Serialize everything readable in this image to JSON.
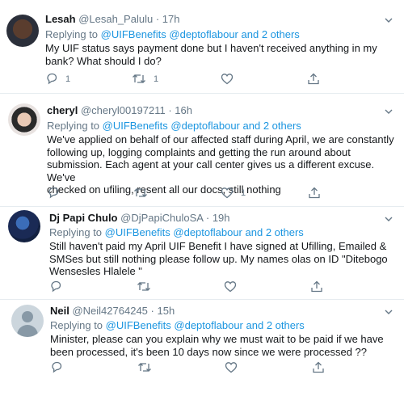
{
  "tweets": [
    {
      "name": "Lesah",
      "handle": "@Lesah_Palulu",
      "sep": "·",
      "time": "17h",
      "replying_prefix": "Replying to",
      "replying_users": "@UIFBenefits @deptoflabour",
      "replying_and": "and",
      "replying_others": "2 others",
      "text_lines": [
        "My UIF status says payment done but I haven't received anything in my",
        "bank?  What should I do?"
      ],
      "reply_count": "1",
      "retweet_count": "1",
      "like_count": ""
    },
    {
      "name": "cheryl",
      "handle": "@cheryl00197211",
      "sep": "·",
      "time": "16h",
      "replying_prefix": "Replying to",
      "replying_users": "@UIFBenefits @deptoflabour",
      "replying_and": "and",
      "replying_others": "2 others",
      "text_lines": [
        "We've applied on behalf of our affected staff during April, we are constantly",
        "following up, logging complaints and getting the run around about",
        "submission. Each agent at your call center gives us a different excuse. We've",
        "checked on ufiling, resent all our docs, still nothing"
      ],
      "reply_count": "",
      "retweet_count": "",
      "like_count": "1"
    },
    {
      "name": "Dj Papi Chulo",
      "handle": "@DjPapiChuloSA",
      "sep": "·",
      "time": "19h",
      "replying_prefix": "Replying to",
      "replying_users": "@UIFBenefits @deptoflabour",
      "replying_and": "and",
      "replying_others": "2 others",
      "text_lines": [
        "Still haven't paid my April UIF Benefit I have signed at Ufilling, Emailed &",
        "SMSes but still nothing please follow up. My names olas on ID \"Ditebogo",
        "Wenseslеs Hlalele \""
      ],
      "reply_count": "",
      "retweet_count": "",
      "like_count": ""
    },
    {
      "name": "Neil",
      "handle": "@Neil42764245",
      "sep": "·",
      "time": "15h",
      "replying_prefix": "Replying to",
      "replying_users": "@UIFBenefits @deptoflabour",
      "replying_and": "and",
      "replying_others": "2 others",
      "text_lines": [
        "Minister, please can you explain why we must wait to be paid if we have",
        "been processed, it's been 10 days now since we were processed ??"
      ],
      "reply_count": "",
      "retweet_count": "",
      "like_count": ""
    }
  ],
  "icons": {
    "reply": "reply-icon",
    "retweet": "retweet-icon",
    "like": "heart-icon",
    "share": "share-icon",
    "more": "chevron-down-icon"
  },
  "colors": {
    "link": "#1b95e0",
    "muted": "#657786",
    "text": "#14171a",
    "divider": "#e6ecf0"
  }
}
